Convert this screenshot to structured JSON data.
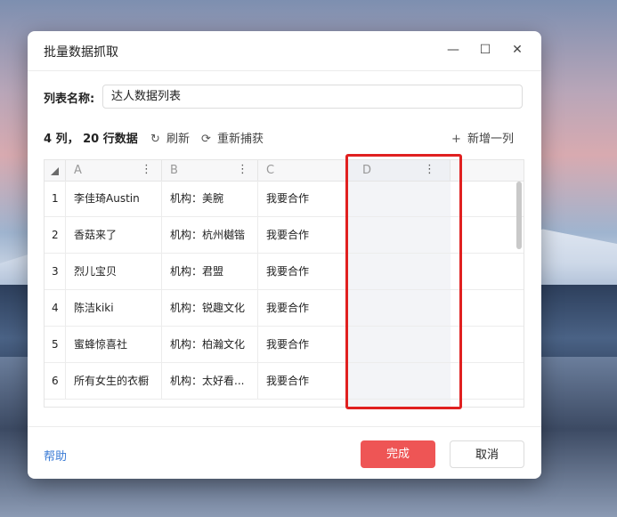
{
  "window": {
    "title": "批量数据抓取"
  },
  "window_controls": {
    "minimize": "—",
    "maximize": "☐",
    "close": "✕"
  },
  "list_name": {
    "label": "列表名称:",
    "value": "达人数据列表"
  },
  "toolbar": {
    "summary": "4 列， 20 行数据",
    "refresh_icon": "↻",
    "refresh": "刷新",
    "recapture_icon": "⟳",
    "recapture": "重新捕获",
    "add_column_icon": "+",
    "add_column": "新增一列"
  },
  "table": {
    "columns": [
      {
        "label": "A",
        "more": "⋮"
      },
      {
        "label": "B",
        "more": "⋮"
      },
      {
        "label": "C",
        "more": "⋮"
      },
      {
        "label": "D",
        "more": "⋮"
      }
    ],
    "rows": [
      {
        "num": "1",
        "a": "李佳琦Austin",
        "b": "机构：美腕",
        "c": "我要合作"
      },
      {
        "num": "2",
        "a": "香菇来了",
        "b": "机构：杭州樾锴",
        "c": "我要合作"
      },
      {
        "num": "3",
        "a": "烈儿宝贝",
        "b": "机构：君盟",
        "c": "我要合作"
      },
      {
        "num": "4",
        "a": "陈洁kiki",
        "b": "机构：锐趣文化",
        "c": "我要合作"
      },
      {
        "num": "5",
        "a": "蜜蜂惊喜社",
        "b": "机构：柏瀚文化",
        "c": "我要合作"
      },
      {
        "num": "6",
        "a": "所有女生的衣橱",
        "b": "机构：太好看...",
        "c": "我要合作"
      }
    ]
  },
  "footer": {
    "help": "帮助",
    "done": "完成",
    "cancel": "取消"
  },
  "colors": {
    "accent": "#ee5555",
    "link": "#3a7bd5",
    "highlight": "#e02020"
  }
}
